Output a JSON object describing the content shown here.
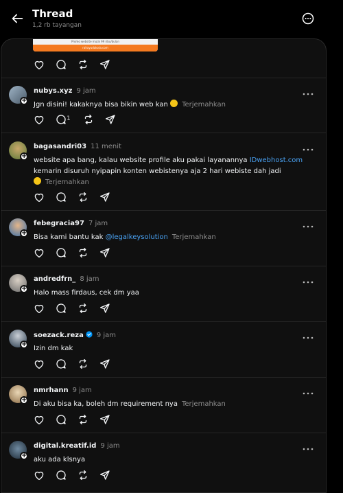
{
  "header": {
    "title": "Thread",
    "subtitle": "1,2 rb tayangan"
  },
  "preview": {
    "caption": "Promo website mulai 99 ribu/bulan",
    "bar_text": "rahayudakota.com"
  },
  "colors": {
    "background": "#000000",
    "card": "#101010",
    "link": "#4aa3f5",
    "muted": "#8d8d8d"
  },
  "posts": [
    {
      "username": "nubys.xyz",
      "time": "9 jam",
      "text": "Jgn disini! kakaknya bisa bikin web kan",
      "emoji": "thinking-face",
      "translate": "Terjemahkan",
      "reply_count": "1"
    },
    {
      "username": "bagasandri03",
      "time": "11 menit",
      "text_before": "website apa bang, kalau website profile aku pakai layanannya",
      "link": "IDwebhost.com",
      "text_after": "kemarin disuruh nyipapin konten webistenya aja 2 hari webiste dah jadi",
      "emoji": "grinning-face",
      "translate": "Terjemahkan"
    },
    {
      "username": "febegracia97",
      "time": "7 jam",
      "text_before": "Bisa kami bantu kak",
      "link": "@legalkeysolution",
      "translate": "Terjemahkan"
    },
    {
      "username": "andredfrn_",
      "time": "8 jam",
      "text": "Halo mass firdaus, cek dm yaa"
    },
    {
      "username": "soezack.reza",
      "time": "9 jam",
      "verified": true,
      "text": "Izin dm kak"
    },
    {
      "username": "nmrhann",
      "time": "9 jam",
      "text": "Di aku bisa ka, boleh dm requirement nya",
      "translate": "Terjemahkan"
    },
    {
      "username": "digital.kreatif.id",
      "time": "9 jam",
      "text": "aku ada klsnya"
    }
  ],
  "icons": [
    "back-arrow-icon",
    "more-circle-icon",
    "like-icon",
    "comment-icon",
    "repost-icon",
    "share-icon",
    "more-dots-icon",
    "follow-plus-icon",
    "verified-icon"
  ]
}
